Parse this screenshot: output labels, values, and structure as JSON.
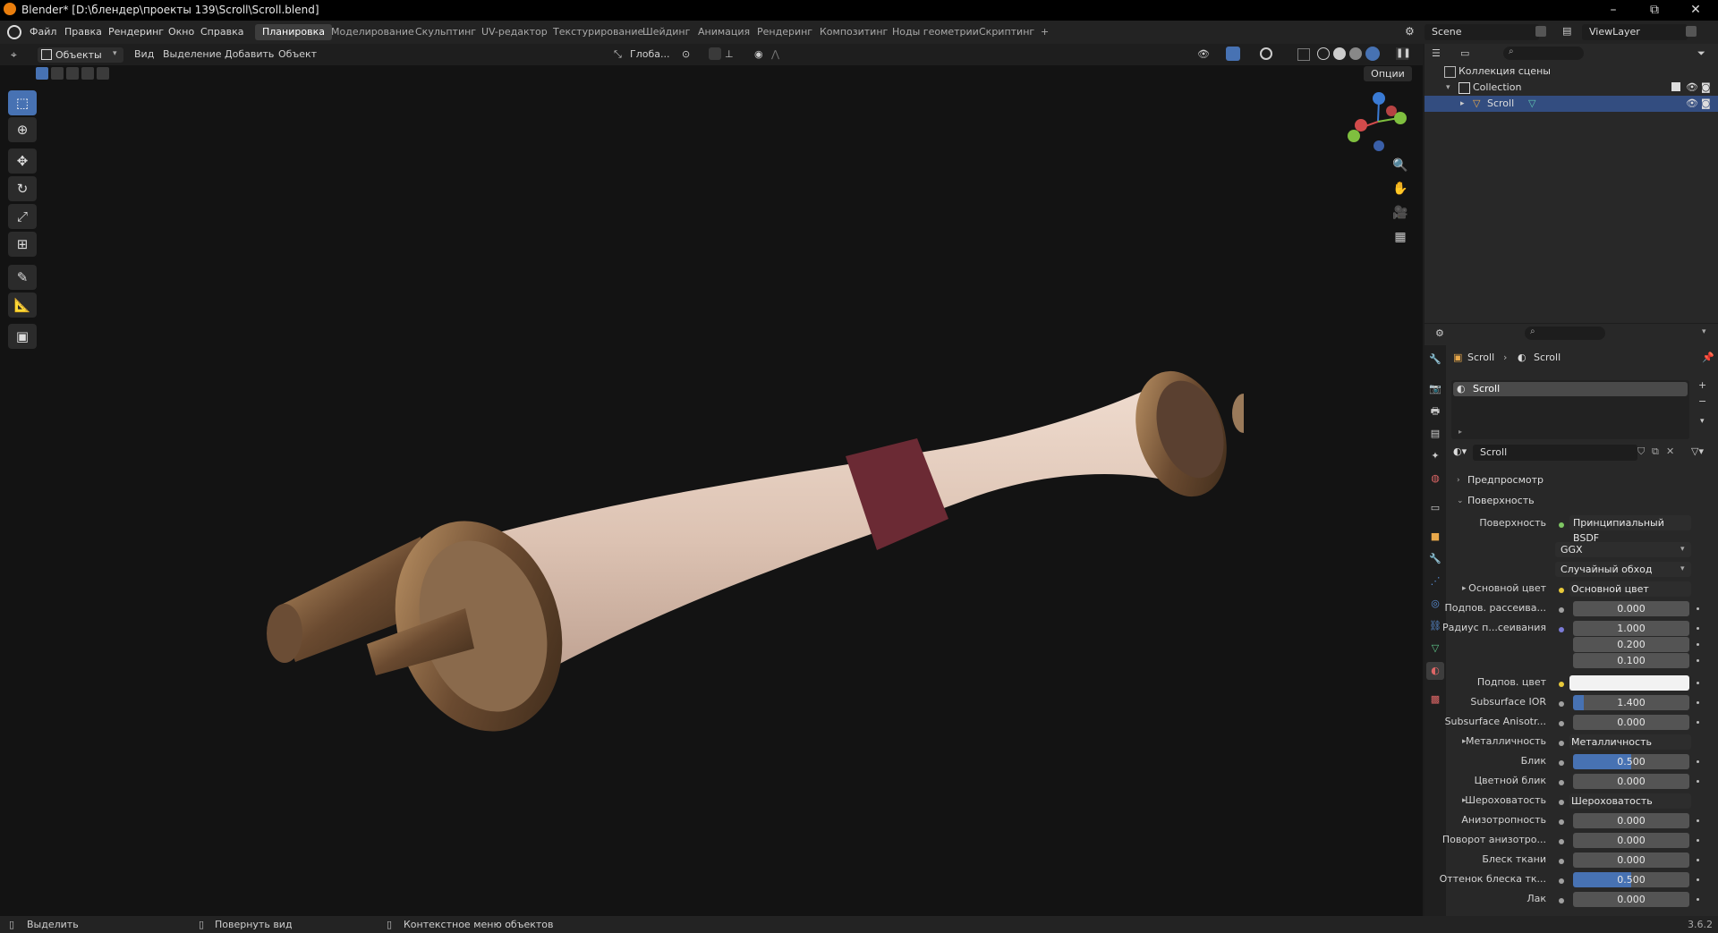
{
  "window": {
    "title": "Blender* [D:\\блендер\\проекты 139\\Scroll\\Scroll.blend]",
    "minimize": "–",
    "maximize": "⧉",
    "close": "✕"
  },
  "menu": [
    "Файл",
    "Правка",
    "Рендеринг",
    "Окно",
    "Справка"
  ],
  "workspaces": [
    "Планировка",
    "Моделирование",
    "Скульптинг",
    "UV-редактор",
    "Текстурирование",
    "Шейдинг",
    "Анимация",
    "Рендеринг",
    "Композитинг",
    "Ноды геометрии",
    "Скриптинг",
    "+"
  ],
  "scene": {
    "name": "Scene",
    "view_layer": "ViewLayer"
  },
  "viewport_header": {
    "mode": "Объекты",
    "menus": [
      "Вид",
      "Выделение",
      "Добавить",
      "Объект"
    ],
    "orientation": "Глоба...",
    "options": "Опции"
  },
  "outliner": {
    "root": "Коллекция сцены",
    "collection": "Collection",
    "object": "Scroll"
  },
  "properties": {
    "breadcrumb": [
      "Scroll",
      "Scroll"
    ],
    "slot": "Scroll",
    "material": "Scroll",
    "panel_preview": "Предпросмотр",
    "panel_surface": "Поверхность",
    "surface_label": "Поверхность",
    "surface_value": "Принципиальный BSDF",
    "distribution": "GGX",
    "subsurface_method": "Случайный обход",
    "rows": [
      {
        "label": "Основной цвет",
        "value": "Основной цвет",
        "kind": "link"
      },
      {
        "label": "Подпов. рассеива...",
        "value": "0.000",
        "kind": "num"
      },
      {
        "label": "Радиус п...сеивания",
        "value": "1.000",
        "kind": "num"
      },
      {
        "label": "",
        "value": "0.200",
        "kind": "num"
      },
      {
        "label": "",
        "value": "0.100",
        "kind": "num"
      },
      {
        "label": "Подпов. цвет",
        "value": "",
        "kind": "color"
      },
      {
        "label": "Subsurface IOR",
        "value": "1.400",
        "kind": "num"
      },
      {
        "label": "Subsurface Anisotr...",
        "value": "0.000",
        "kind": "num"
      },
      {
        "label": "Металличность",
        "value": "Металличность",
        "kind": "link"
      },
      {
        "label": "Блик",
        "value": "0.500",
        "kind": "slider"
      },
      {
        "label": "Цветной блик",
        "value": "0.000",
        "kind": "num"
      },
      {
        "label": "Шероховатость",
        "value": "Шероховатость",
        "kind": "link"
      },
      {
        "label": "Анизотропность",
        "value": "0.000",
        "kind": "num"
      },
      {
        "label": "Поворот анизотро...",
        "value": "0.000",
        "kind": "num"
      },
      {
        "label": "Блеск ткани",
        "value": "0.000",
        "kind": "num"
      },
      {
        "label": "Оттенок блеска тк...",
        "value": "0.500",
        "kind": "slider"
      },
      {
        "label": "Лак",
        "value": "0.000",
        "kind": "num"
      }
    ]
  },
  "status": {
    "select": "Выделить",
    "rotate": "Повернуть вид",
    "context": "Контекстное меню объектов",
    "version": "3.6.2"
  },
  "colors": {
    "accent": "#4772b3",
    "title_bg": "#000000",
    "viewport_bg": "#131313",
    "panel_bg": "#282828"
  }
}
